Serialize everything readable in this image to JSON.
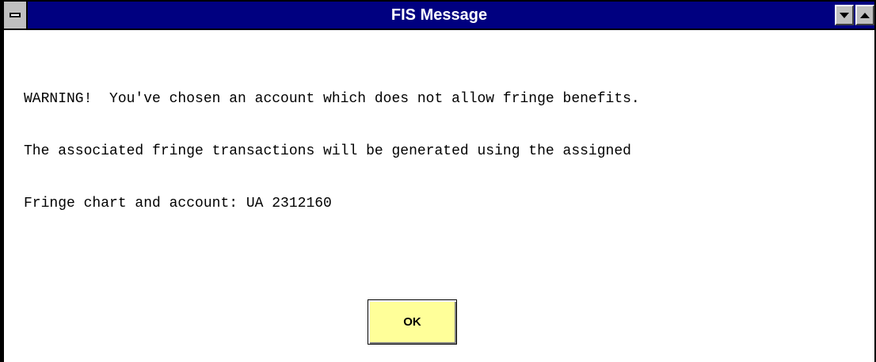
{
  "window": {
    "title": "FIS Message"
  },
  "message": {
    "lines": [
      "WARNING!  You've chosen an account which does not allow fringe benefits.",
      "The associated fringe transactions will be generated using the assigned",
      "Fringe chart and account: UA 2312160"
    ]
  },
  "buttons": {
    "ok_label": "OK"
  },
  "colors": {
    "titlebar": "#000080",
    "button_face": "#ffff99"
  },
  "icons": {
    "system_menu": "system-menu-icon",
    "minimize": "minimize-icon",
    "maximize": "maximize-icon"
  }
}
